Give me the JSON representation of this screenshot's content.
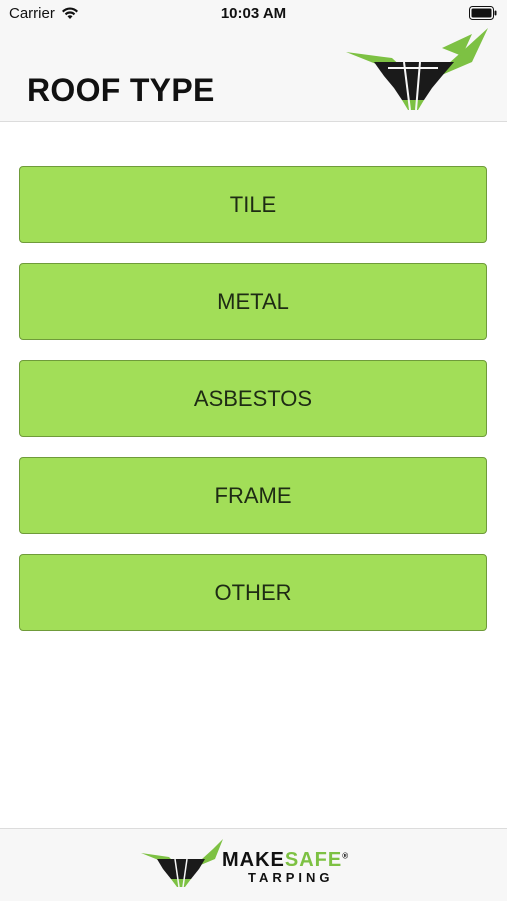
{
  "status_bar": {
    "carrier": "Carrier",
    "time": "10:03 AM"
  },
  "header": {
    "title": "ROOF TYPE"
  },
  "buttons": [
    {
      "label": "TILE"
    },
    {
      "label": "METAL"
    },
    {
      "label": "ASBESTOS"
    },
    {
      "label": "FRAME"
    },
    {
      "label": "OTHER"
    }
  ],
  "footer": {
    "brand_make": "MAKE",
    "brand_safe": "SAFE",
    "brand_reg": "®",
    "brand_sub": "TARPING"
  },
  "colors": {
    "button_fill": "#a2de58",
    "button_border": "#6f9b3a",
    "brand_green": "#7dc143"
  }
}
